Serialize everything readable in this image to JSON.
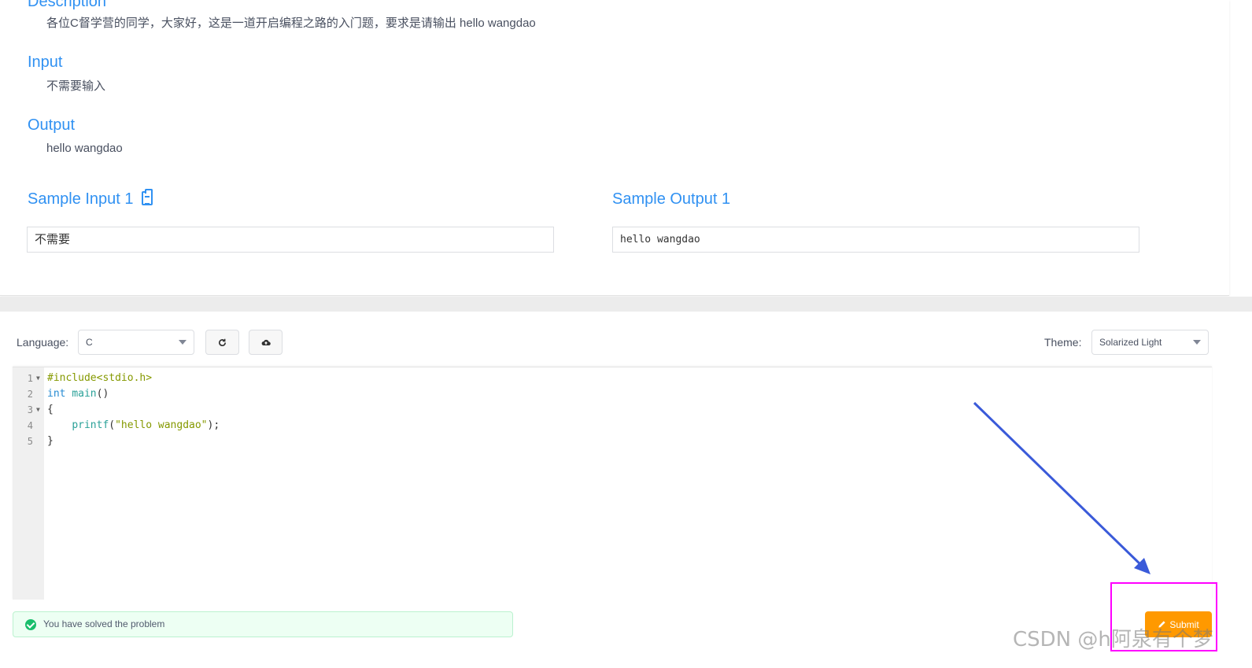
{
  "problem": {
    "description_heading": "Description",
    "description_text": "各位C督学营的同学，大家好，这是一道开启编程之路的入门题，要求是请输出 hello wangdao",
    "input_heading": "Input",
    "input_text": "不需要输入",
    "output_heading": "Output",
    "output_text": "hello wangdao",
    "sample_input_heading": "Sample Input 1",
    "sample_input_value": "不需要",
    "sample_output_heading": "Sample Output 1",
    "sample_output_value": "hello wangdao"
  },
  "toolbar": {
    "language_label": "Language:",
    "language_value": "C",
    "reset_icon": "refresh-icon",
    "upload_icon": "cloud-upload-icon",
    "theme_label": "Theme:",
    "theme_value": "Solarized Light"
  },
  "editor": {
    "lines": [
      {
        "n": "1",
        "fold": true,
        "parts": [
          {
            "t": "#include<stdio.h>",
            "c": "c-pre"
          }
        ]
      },
      {
        "n": "2",
        "fold": false,
        "parts": [
          {
            "t": "int",
            "c": "c-kw"
          },
          {
            "t": " ",
            "c": "c-p"
          },
          {
            "t": "main",
            "c": "c-fn"
          },
          {
            "t": "()",
            "c": "c-p"
          }
        ]
      },
      {
        "n": "3",
        "fold": true,
        "parts": [
          {
            "t": "{",
            "c": "c-p"
          }
        ]
      },
      {
        "n": "4",
        "fold": false,
        "parts": [
          {
            "t": "    ",
            "c": "c-p"
          },
          {
            "t": "printf",
            "c": "c-fn"
          },
          {
            "t": "(",
            "c": "c-p"
          },
          {
            "t": "\"hello wangdao\"",
            "c": "c-str"
          },
          {
            "t": ");",
            "c": "c-p"
          }
        ]
      },
      {
        "n": "5",
        "fold": false,
        "parts": [
          {
            "t": "}",
            "c": "c-p"
          }
        ]
      }
    ]
  },
  "status": {
    "message": "You have solved the problem",
    "color": "#19be6b"
  },
  "submit": {
    "label": "Submit",
    "icon": "pencil-icon",
    "color": "#ff9900"
  },
  "annotation": {
    "highlight_color": "#ff00ff",
    "arrow_color": "#3a5ad9"
  },
  "watermark": "CSDN @h阿泉有个梦"
}
